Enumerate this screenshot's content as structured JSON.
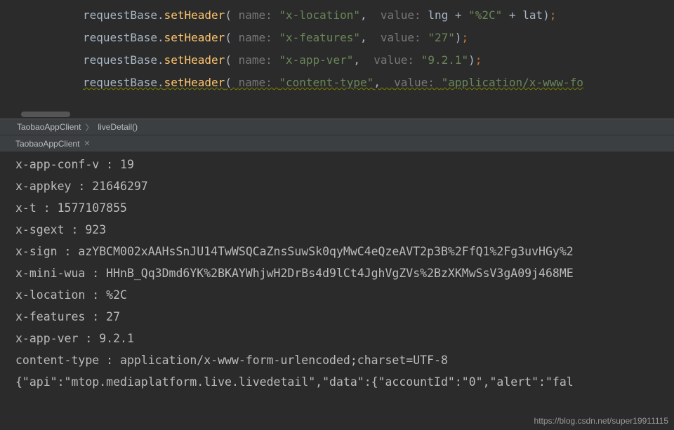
{
  "editor": {
    "lines": [
      {
        "obj": "requestBase",
        "method": "setHeader",
        "nameHint": "name:",
        "nameVal": "\"x-location\"",
        "valueHint": "value:",
        "valueExpr": [
          {
            "t": "var",
            "s": "lng"
          },
          {
            "t": "op",
            "s": " + "
          },
          {
            "t": "str",
            "s": "\"%2C\""
          },
          {
            "t": "op",
            "s": " + "
          },
          {
            "t": "var",
            "s": "lat"
          }
        ],
        "squiggle": false
      },
      {
        "obj": "requestBase",
        "method": "setHeader",
        "nameHint": "name:",
        "nameVal": "\"x-features\"",
        "valueHint": "value:",
        "valueExpr": [
          {
            "t": "str",
            "s": "\"27\""
          }
        ],
        "squiggle": false
      },
      {
        "obj": "requestBase",
        "method": "setHeader",
        "nameHint": "name:",
        "nameVal": "\"x-app-ver\"",
        "valueHint": "value:",
        "valueExpr": [
          {
            "t": "str",
            "s": "\"9.2.1\""
          }
        ],
        "squiggle": false
      },
      {
        "obj": "requestBase",
        "method": "setHeader",
        "nameHint": "name:",
        "nameVal": "\"content-type\"",
        "valueHint": "value:",
        "valueExpr": [
          {
            "t": "str",
            "s": "\"application/x-www-fo"
          }
        ],
        "squiggle": true,
        "noClose": true
      }
    ]
  },
  "breadcrumb": {
    "class": "TaobaoAppClient",
    "method": "liveDetail()"
  },
  "tab": {
    "label": "TaobaoAppClient"
  },
  "console": {
    "lines": [
      "x-app-conf-v : 19",
      "x-appkey : 21646297",
      "x-t : 1577107855",
      "x-sgext : 923",
      "x-sign : azYBCM002xAAHsSnJU14TwWSQCaZnsSuwSk0qyMwC4eQzeAVT2p3B%2FfQ1%2Fg3uvHGy%2",
      "x-mini-wua : HHnB_Qq3Dmd6YK%2BKAYWhjwH2DrBs4d9lCt4JghVgZVs%2BzXKMwSsV3gA09j468ME",
      "x-location : %2C",
      "x-features : 27",
      "x-app-ver : 9.2.1",
      "content-type : application/x-www-form-urlencoded;charset=UTF-8",
      "{\"api\":\"mtop.mediaplatform.live.livedetail\",\"data\":{\"accountId\":\"0\",\"alert\":\"fal"
    ]
  },
  "watermark": "https://blog.csdn.net/super19911115"
}
